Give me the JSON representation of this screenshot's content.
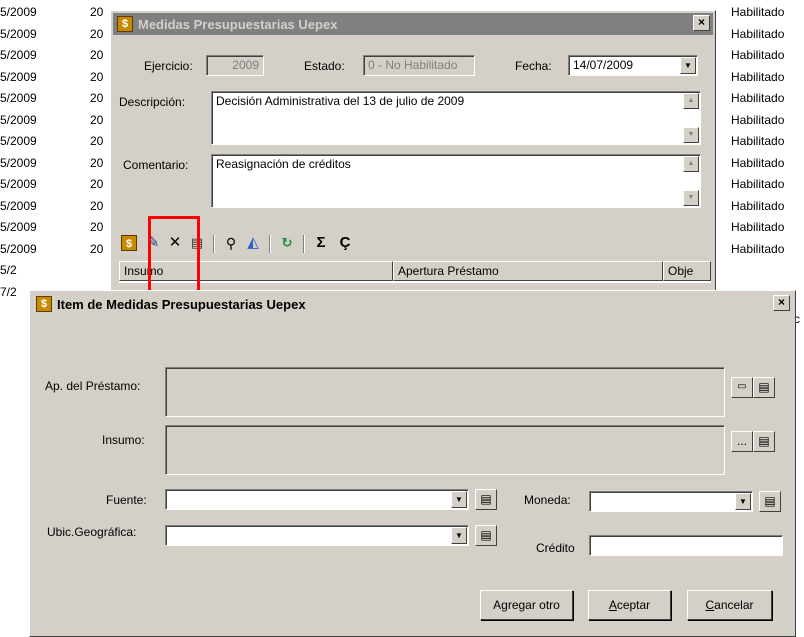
{
  "background_list": {
    "rows": [
      {
        "date": "5/2009",
        "year": "20",
        "status": "Habilitado"
      },
      {
        "date": "5/2009",
        "year": "20",
        "status": "Habilitado"
      },
      {
        "date": "5/2009",
        "year": "20",
        "status": "Habilitado"
      },
      {
        "date": "5/2009",
        "year": "20",
        "status": "Habilitado"
      },
      {
        "date": "5/2009",
        "year": "20",
        "status": "Habilitado"
      },
      {
        "date": "5/2009",
        "year": "20",
        "status": "Habilitado"
      },
      {
        "date": "5/2009",
        "year": "20",
        "status": "Habilitado"
      },
      {
        "date": "5/2009",
        "year": "20",
        "status": "Habilitado"
      },
      {
        "date": "5/2009",
        "year": "20",
        "status": "Habilitado"
      },
      {
        "date": "5/2009",
        "year": "20",
        "status": "Habilitado"
      },
      {
        "date": "5/2009",
        "year": "20",
        "status": "Habilitado"
      },
      {
        "date": "5/2009",
        "year": "20",
        "status": "Habilitado"
      },
      {
        "date": "5/2",
        "year": "",
        "status": ""
      },
      {
        "date": "7/2",
        "year": "",
        "status": ""
      }
    ],
    "trailing_char": "c"
  },
  "window_medidas": {
    "title": "Medidas Presupuestarias Uepex",
    "close_label": "×",
    "ejercicio_label": "Ejercicio:",
    "ejercicio_value": "2009",
    "estado_label": "Estado:",
    "estado_value": "0 - No Habilitado",
    "fecha_label": "Fecha:",
    "fecha_value": "14/07/2009",
    "descripcion_label": "Descripción:",
    "descripcion_value": "Decisión Administrativa del 13 de julio de 2009",
    "comentario_label": "Comentario:",
    "comentario_value": "Reasignación de créditos",
    "toolbar": {
      "sigma": "Σ",
      "cedilla": "Ç"
    },
    "grid_columns": [
      "Insumo",
      "Apertura Préstamo",
      "Obje"
    ]
  },
  "window_item": {
    "title": "Item de Medidas Presupuestarias Uepex",
    "close_label": "×",
    "prestamo_label": "Ap. del Préstamo:",
    "insumo_label": "Insumo:",
    "insumo_ellipsis": "...",
    "fuente_label": "Fuente:",
    "moneda_label": "Moneda:",
    "ubic_label": "Ubic.Geográfica:",
    "credito_label": "Crédito",
    "buttons": {
      "agregar": "Agregar otro",
      "aceptar_prefix": "",
      "aceptar_underlined": "A",
      "aceptar_rest": "ceptar",
      "cancelar_underlined": "C",
      "cancelar_rest": "ancelar"
    }
  },
  "highlight_color": "#ff0000",
  "titlebar_inactive_color": "#808080"
}
